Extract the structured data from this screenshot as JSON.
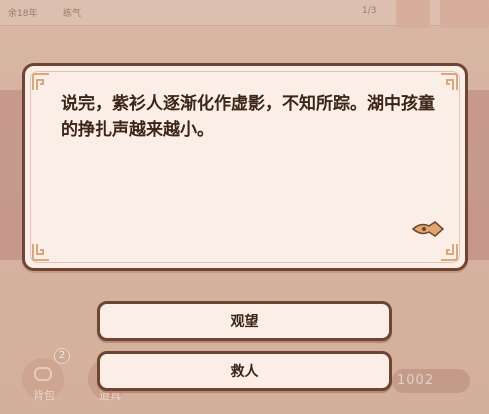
{
  "hud": {
    "age": "余18年",
    "skill": "练气",
    "pager": "1/3"
  },
  "dialog": {
    "text": "说完，紫衫人逐渐化作虚影，不知所踪。湖中孩童的挣扎声越来越小。",
    "next_icon": "next-arrow-icon"
  },
  "choices": [
    {
      "label": "观望"
    },
    {
      "label": "救人"
    }
  ],
  "bottom_bar": {
    "bag_label": "背包",
    "bag_badge": "2",
    "props_label": "道具",
    "coins": "1002"
  },
  "colors": {
    "panel_bg": "#fbeee6",
    "panel_border": "#6e4534",
    "text": "#3b2418",
    "accent": "#d99a62"
  }
}
